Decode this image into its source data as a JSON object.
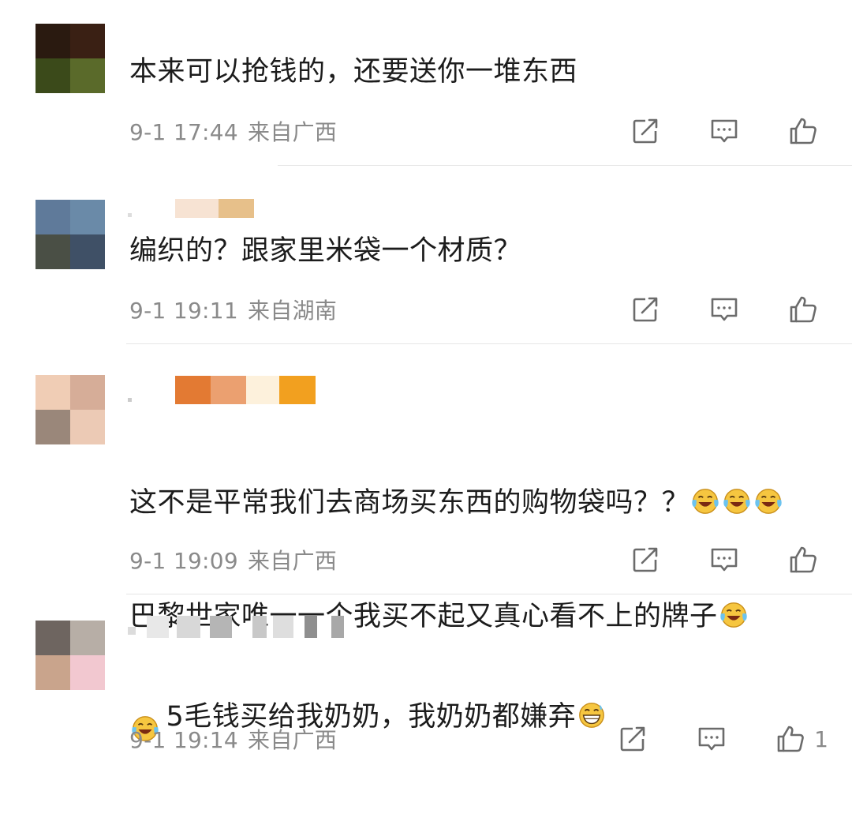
{
  "comments": [
    {
      "avatar_colors": [
        "#2a1a10",
        "#3a2014",
        "#3b4a1a",
        "#5a6a2a"
      ],
      "name_blur_colors": [],
      "text": "本来可以抢钱的，还要送你一堆东西",
      "time": "9-1 17:44",
      "location": "来自广西",
      "likes": ""
    },
    {
      "avatar_colors": [
        "#5f7a9a",
        "#6a8aa8",
        "#4a4f45",
        "#3f5066"
      ],
      "name_blur_colors": [
        "#f7e3d3",
        "#e7c08a"
      ],
      "text": "编织的？跟家里米袋一个材质？",
      "time": "9-1 19:11",
      "location": "来自湖南",
      "likes": ""
    },
    {
      "avatar_colors": [
        "#f0cdb5",
        "#d6ad98",
        "#9a877a",
        "#eccab5"
      ],
      "name_blur_colors": [
        "#e37a33",
        "#eba070",
        "#fdf1dc",
        "#f2a01f"
      ],
      "text_line1": "这不是平常我们去商场买东西的购物袋吗？？",
      "text_line2": "巴黎世家唯一一个我买不起又真心看不上的牌子",
      "emoji_name": "laugh-cry-emoji",
      "time": "9-1 19:09",
      "location": "来自广西",
      "likes": ""
    },
    {
      "avatar_colors": [
        "#6e6560",
        "#b7aea6",
        "#c9a48c",
        "#f2c8d0"
      ],
      "name_blur_colors": [
        "#dcdcdc",
        "#bdbdbd",
        "#9a9a9a",
        "#d0d0d0",
        "#8f8f8f",
        "#c4c4c4"
      ],
      "text": "5毛钱买给我奶奶，我奶奶都嫌弃",
      "emoji_name": "grin-sweat-emoji",
      "time": "9-1 19:14",
      "location": "来自广西",
      "likes": "1"
    }
  ],
  "icons": {
    "share": "share-icon",
    "comment": "comment-icon",
    "like": "thumbs-up-icon"
  },
  "colors": {
    "meta": "#8a8a8a",
    "divider": "#e6e6e6",
    "icon": "#6b6b6b"
  }
}
